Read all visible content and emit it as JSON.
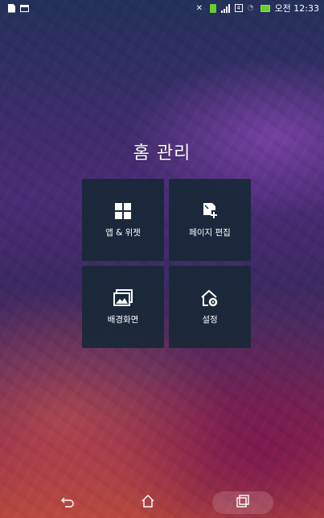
{
  "status_bar": {
    "left_icons": [
      "document-icon",
      "card-icon"
    ],
    "right_icons": [
      "mute-icon",
      "sim-icon",
      "signal-icon",
      "lte-icon",
      "wifi-icon",
      "battery-icon"
    ],
    "clock": "오전 12:33"
  },
  "home_manage": {
    "title": "홈 관리",
    "tiles": [
      {
        "label": "앱 & 위젯",
        "icon": "apps-widgets-icon"
      },
      {
        "label": "페이지 편집",
        "icon": "page-edit-icon"
      },
      {
        "label": "배경화면",
        "icon": "wallpaper-icon"
      },
      {
        "label": "설정",
        "icon": "home-settings-icon"
      }
    ]
  },
  "nav_bar": {
    "buttons": [
      "back-icon",
      "home-icon",
      "recent-apps-icon"
    ]
  },
  "colors": {
    "tile_bg": "#182837",
    "battery": "#6acf2a"
  }
}
